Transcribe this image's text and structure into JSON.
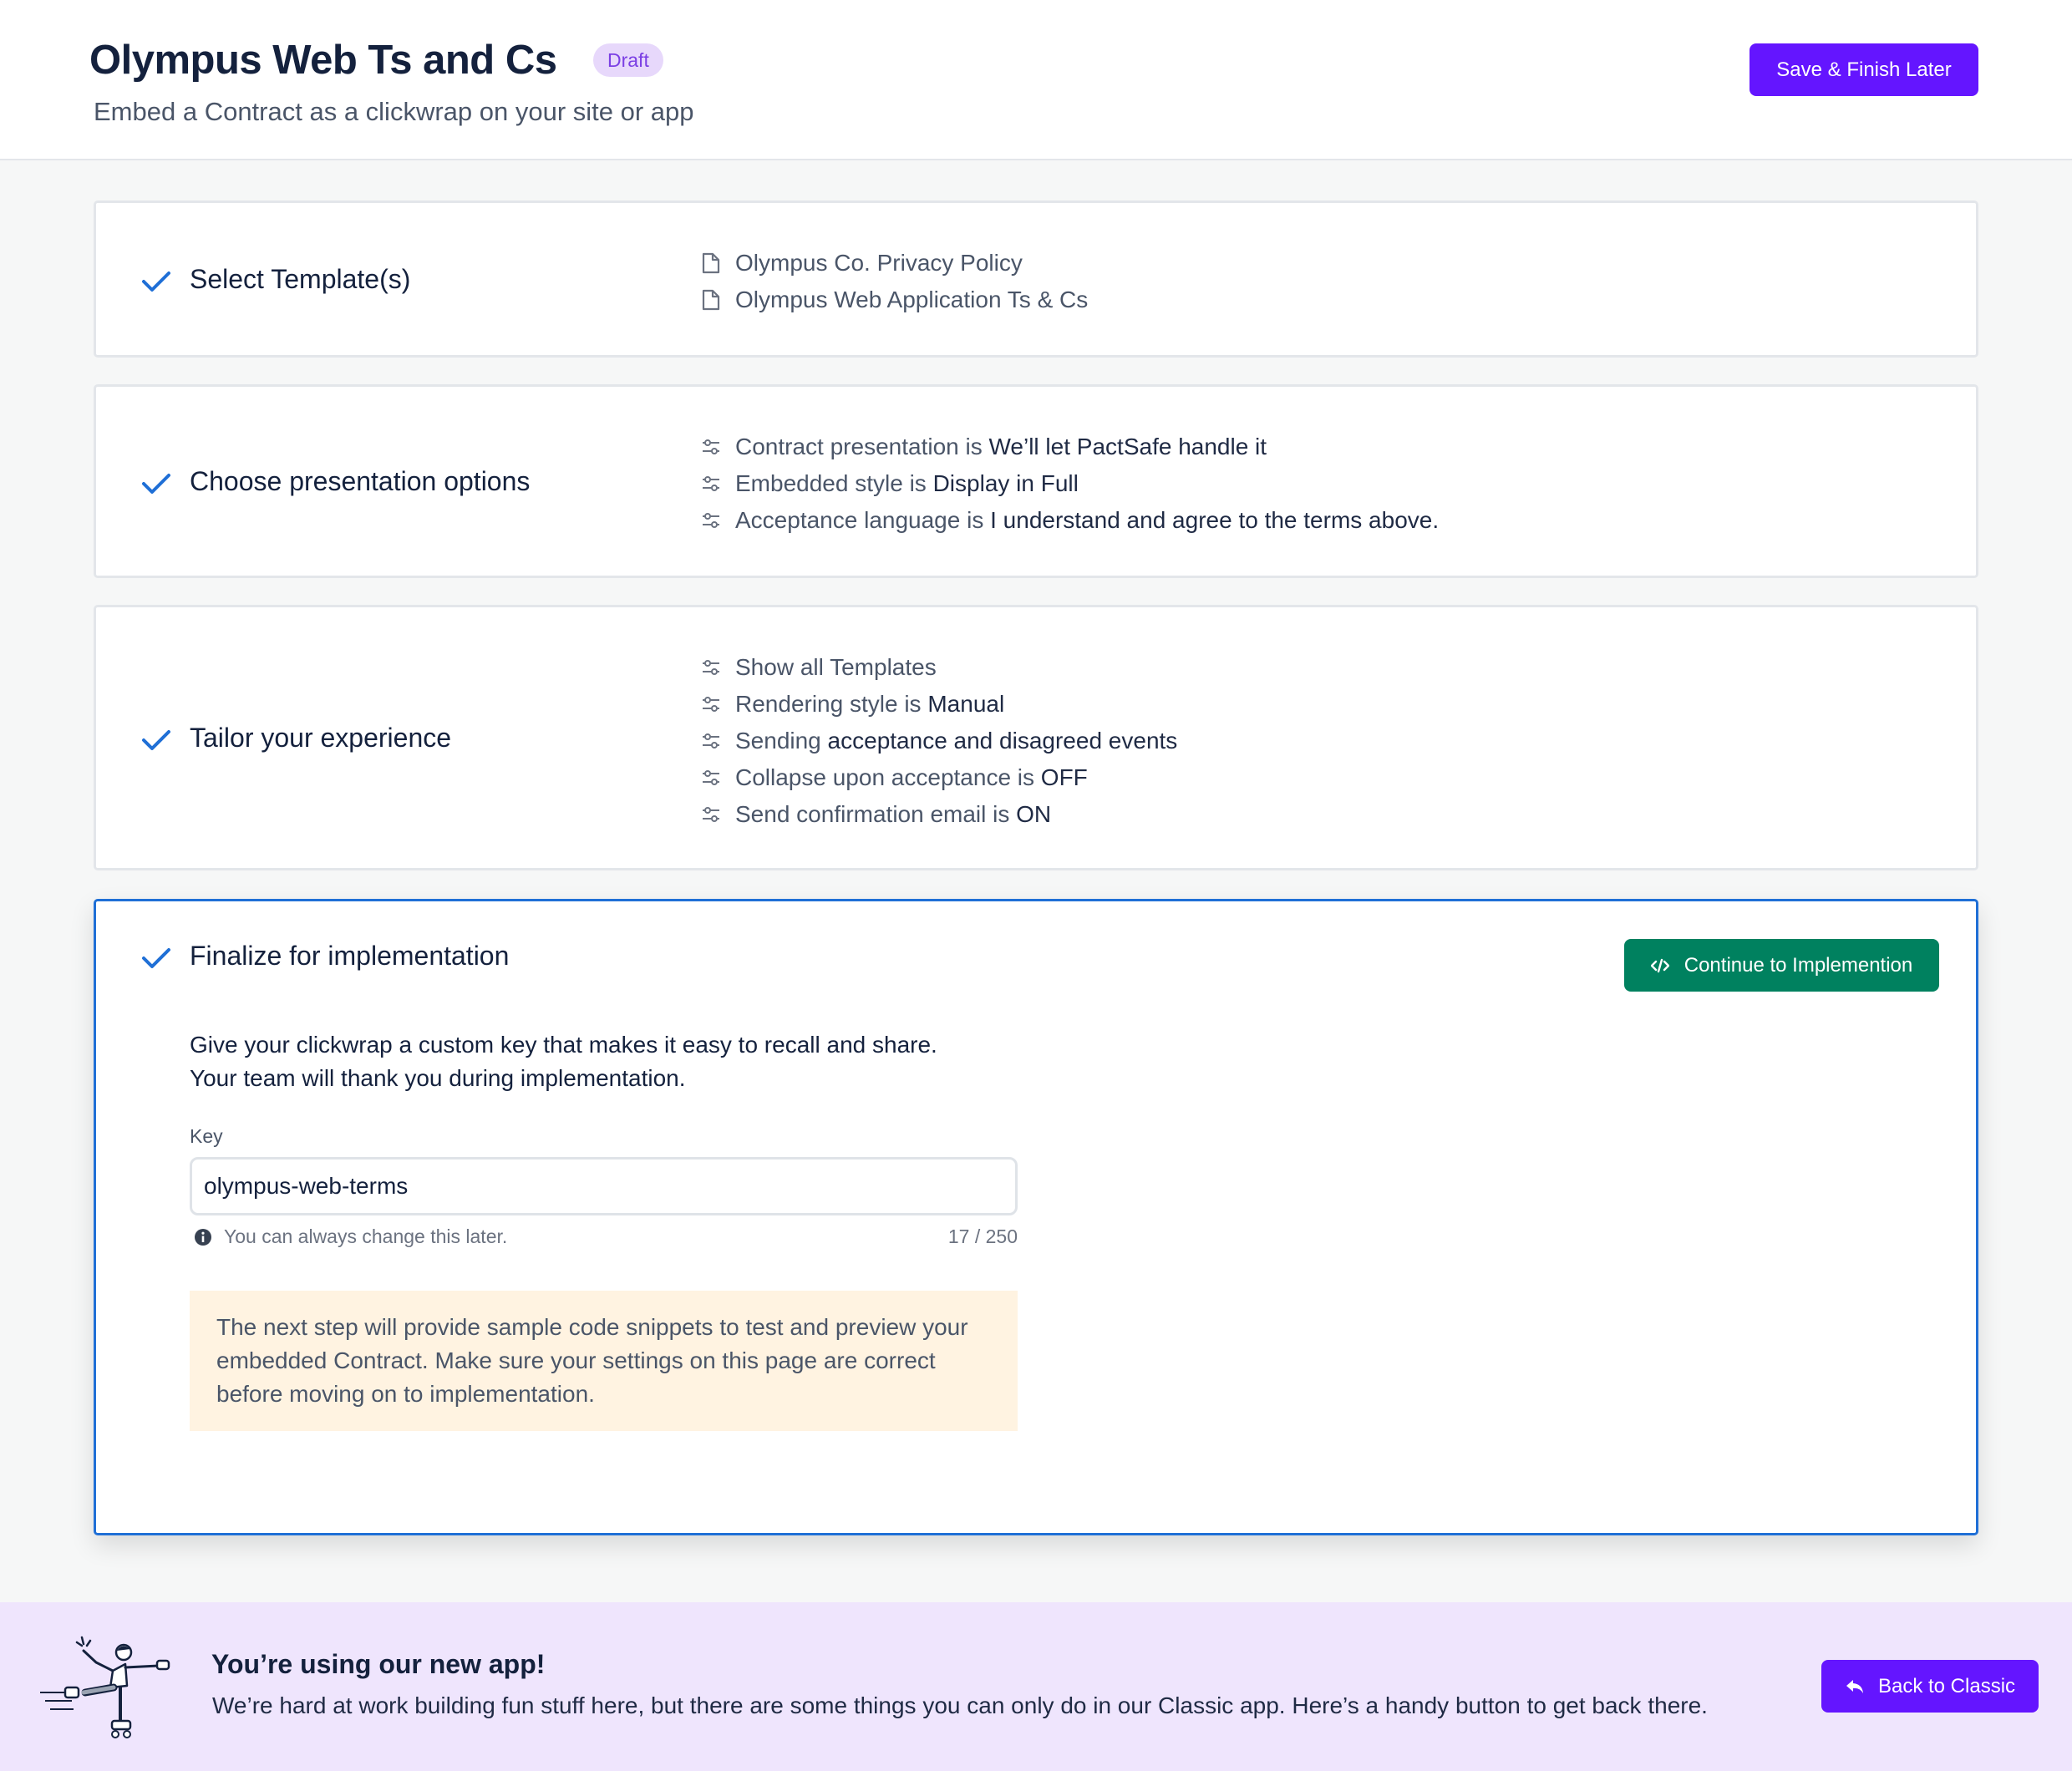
{
  "header": {
    "title": "Olympus Web Ts and Cs",
    "badge": "Draft",
    "subtitle": "Embed a Contract as a clickwrap on your site or app",
    "save_label": "Save & Finish Later"
  },
  "steps": {
    "templates": {
      "title": "Select Template(s)",
      "items": [
        "Olympus Co. Privacy Policy",
        "Olympus Web Application Ts & Cs"
      ]
    },
    "presentation": {
      "title": "Choose presentation options",
      "items": [
        {
          "prefix": "Contract presentation is ",
          "value": "We’ll let PactSafe handle it"
        },
        {
          "prefix": "Embedded style is ",
          "value": "Display in Full"
        },
        {
          "prefix": "Acceptance language is ",
          "value": "I understand and agree to the terms above."
        }
      ]
    },
    "experience": {
      "title": "Tailor your experience",
      "items": [
        {
          "prefix": "Show all Templates",
          "value": ""
        },
        {
          "prefix": "Rendering style is ",
          "value": "Manual"
        },
        {
          "prefix": "Sending ",
          "value": "acceptance and disagreed events"
        },
        {
          "prefix": "Collapse upon acceptance is ",
          "value": "OFF"
        },
        {
          "prefix": "Send confirmation email is ",
          "value": "ON"
        }
      ]
    },
    "finalize": {
      "title": "Finalize for implementation",
      "continue_label": "Continue to Implemention",
      "desc_line1": "Give your clickwrap a custom key that makes it easy to recall and share.",
      "desc_line2": "Your team will thank you during implementation.",
      "key_label": "Key",
      "key_value": "olympus-web-terms",
      "hint": "You can always change this later.",
      "counter": "17 / 250",
      "notice": "The next step will provide sample code snippets to test and preview your embedded Contract. Make sure your settings on this page are correct before moving on to implementation."
    }
  },
  "banner": {
    "title": "You’re using our new app!",
    "text": "We’re hard at work building fun stuff here, but there are some things you can only do in our Classic app. Here’s a handy button to get back there.",
    "button_label": "Back to Classic"
  },
  "colors": {
    "primary": "#6415ff",
    "success": "#00815f",
    "active_border": "#1f6fd6",
    "badge_bg": "#e7d8fb",
    "notice_bg": "#fff3e1",
    "banner_bg": "#efe5fd"
  },
  "icons": {
    "check": "check-icon",
    "document": "document-icon",
    "sliders": "sliders-icon",
    "code": "code-icon",
    "info": "info-icon",
    "back": "reply-arrow-icon"
  }
}
